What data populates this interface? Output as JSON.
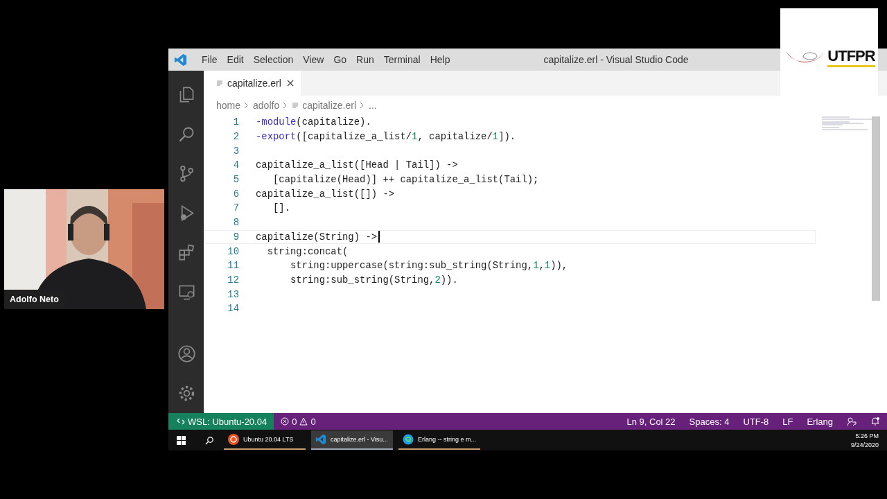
{
  "webcam": {
    "name": "Adolfo Neto"
  },
  "logo": {
    "text": "UTFPR"
  },
  "window": {
    "title": "capitalize.erl - Visual Studio Code",
    "menu": [
      "File",
      "Edit",
      "Selection",
      "View",
      "Go",
      "Run",
      "Terminal",
      "Help"
    ]
  },
  "activity_bar": [
    {
      "kind": "explorer",
      "selected": false
    },
    {
      "kind": "search",
      "selected": false
    },
    {
      "kind": "source-control",
      "selected": false
    },
    {
      "kind": "run",
      "selected": false
    },
    {
      "kind": "extensions",
      "selected": false
    },
    {
      "kind": "remote",
      "selected": false
    }
  ],
  "activity_bottom": [
    {
      "kind": "account"
    },
    {
      "kind": "settings"
    }
  ],
  "tabs": [
    {
      "label": "capitalize.erl",
      "selected": true
    }
  ],
  "breadcrumb": [
    "home",
    "adolfo",
    "capitalize.erl",
    "..."
  ],
  "lines": [
    {
      "number": "1",
      "tokens": [
        {
          "kind": "directive",
          "text": "-module"
        },
        {
          "kind": "plain",
          "text": "(capitalize)."
        }
      ]
    },
    {
      "number": "2",
      "tokens": [
        {
          "kind": "directive",
          "text": "-export"
        },
        {
          "kind": "plain",
          "text": "([capitalize_a_list/"
        },
        {
          "kind": "number",
          "text": "1"
        },
        {
          "kind": "plain",
          "text": ", capitalize/"
        },
        {
          "kind": "number",
          "text": "1"
        },
        {
          "kind": "plain",
          "text": "])."
        }
      ]
    },
    {
      "number": "3",
      "current": false
    },
    {
      "number": "4",
      "tokens": [
        {
          "kind": "plain",
          "text": "capitalize_a_list([Head | Tail]) ->"
        }
      ]
    },
    {
      "number": "5",
      "tokens": [
        {
          "kind": "plain",
          "text": "   [capitalize(Head)] ++ capitalize_a_list(Tail);"
        }
      ]
    },
    {
      "number": "6",
      "tokens": [
        {
          "kind": "plain",
          "text": "capitalize_a_list([]) ->"
        }
      ]
    },
    {
      "number": "7",
      "tokens": [
        {
          "kind": "plain",
          "text": "   []."
        }
      ]
    },
    {
      "number": "8",
      "current": false
    },
    {
      "number": "9",
      "current": true,
      "tokens": [
        {
          "kind": "plain",
          "text": "capitalize(String) ->"
        }
      ]
    },
    {
      "number": "10",
      "tokens": [
        {
          "kind": "plain",
          "text": "  string:concat("
        }
      ]
    },
    {
      "number": "11",
      "tokens": [
        {
          "kind": "plain",
          "text": "      string:uppercase(string:sub_string(String,"
        },
        {
          "kind": "number",
          "text": "1"
        },
        {
          "kind": "plain",
          "text": ","
        },
        {
          "kind": "number",
          "text": "1"
        },
        {
          "kind": "plain",
          "text": ")),"
        }
      ]
    },
    {
      "number": "12",
      "tokens": [
        {
          "kind": "plain",
          "text": "      string:sub_string(String,"
        },
        {
          "kind": "number",
          "text": "2"
        },
        {
          "kind": "plain",
          "text": "))."
        }
      ]
    },
    {
      "number": "13",
      "current": false
    },
    {
      "number": "14",
      "current": false
    }
  ],
  "status_bar": {
    "remote": "WSL: Ubuntu-20.04",
    "errors": "0",
    "warnings": "0",
    "right": [
      "Ln 9, Col 22",
      "Spaces: 4",
      "UTF-8",
      "LF",
      "Erlang"
    ]
  },
  "taskbar": {
    "apps": [
      {
        "kind": "ubuntu",
        "label": "Ubuntu 20.04 LTS",
        "selected": false
      },
      {
        "kind": "vscode",
        "label": "capitalize.erl - Visu...",
        "selected": true
      },
      {
        "kind": "edge",
        "label": "Erlang -- string e m...",
        "selected": false
      }
    ],
    "time": "5:26 PM",
    "date": "9/24/2020"
  }
}
